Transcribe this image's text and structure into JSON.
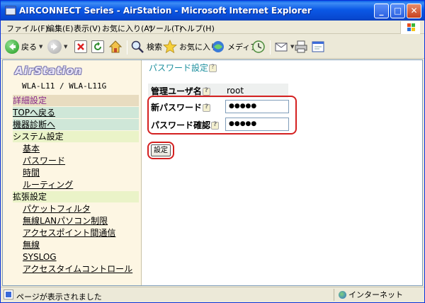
{
  "window": {
    "title": "AIRCONNECT Series - AirStation - Microsoft Internet Explorer",
    "min_label": "_",
    "max_label": "□",
    "close_label": "✕"
  },
  "menu": [
    "ファイル(F)",
    "編集(E)",
    "表示(V)",
    "お気に入り(A)",
    "ツール(T)",
    "ヘルプ(H)"
  ],
  "toolbar": {
    "back_label": "戻る",
    "search_label": "検索",
    "favorites_label": "お気に入り",
    "media_label": "メディア"
  },
  "sidebar": {
    "logo": "AirStation",
    "model": "WLA-L11 / WLA-L11G",
    "items": [
      {
        "label": "詳細設定",
        "kind": "section"
      },
      {
        "label": "TOPへ戻る",
        "kind": "link-hl"
      },
      {
        "label": "機器診断へ",
        "kind": "link-hl"
      },
      {
        "label": "システム設定",
        "kind": "category"
      },
      {
        "label": "基本",
        "kind": "sub"
      },
      {
        "label": "パスワード",
        "kind": "sub"
      },
      {
        "label": "時間",
        "kind": "sub"
      },
      {
        "label": "ルーティング",
        "kind": "sub"
      },
      {
        "label": "拡張設定",
        "kind": "category"
      },
      {
        "label": "パケットフィルタ",
        "kind": "sub"
      },
      {
        "label": "無線LANパソコン制限",
        "kind": "sub"
      },
      {
        "label": "アクセスポイント間通信",
        "kind": "sub"
      },
      {
        "label": "無線",
        "kind": "sub"
      },
      {
        "label": "SYSLOG",
        "kind": "sub"
      },
      {
        "label": "アクセスタイムコントロール",
        "kind": "sub"
      }
    ]
  },
  "main": {
    "title": "パスワード設定",
    "admin_user_label": "管理ユーザ名",
    "admin_user_value": "root",
    "new_password_label": "新パスワード",
    "new_password_value": "●●●●●",
    "confirm_password_label": "パスワード確認",
    "confirm_password_value": "●●●●●",
    "submit_label": "設定"
  },
  "status": {
    "text": "ページが表示されました",
    "zone": "インターネット"
  },
  "colors": {
    "title_teal": "#1c8f9e",
    "highlight_red": "#d42020",
    "titlebar_blue": "#0b58e6"
  }
}
